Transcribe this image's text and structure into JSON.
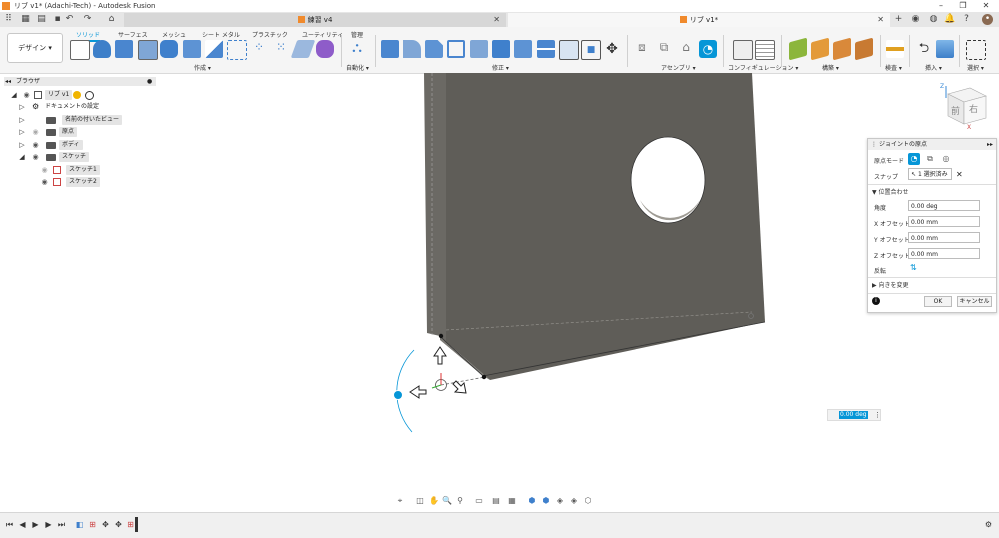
{
  "titlebar": {
    "title": "リブ v1* (Adachi-Tech) - Autodesk Fusion"
  },
  "doc_tabs": [
    {
      "label": "練習 v4"
    },
    {
      "label": "リブ v1*"
    }
  ],
  "toolbar": {
    "workspace": "デザイン ▾",
    "tabs": [
      "ソリッド",
      "サーフェス",
      "メッシュ",
      "シート メタル",
      "プラスチック",
      "ユーティリティ",
      "管理"
    ],
    "groups": [
      "作成 ▾",
      "自動化 ▾",
      "修正 ▾",
      "アセンブリ ▾",
      "コンフィギュレーション ▾",
      "構築 ▾",
      "検査 ▾",
      "挿入 ▾",
      "選択 ▾"
    ]
  },
  "browser": {
    "title": "ブラウザ",
    "items": [
      {
        "label": "リブ v1"
      },
      {
        "label": "ドキュメントの設定"
      },
      {
        "label": "名前の付いたビュー"
      },
      {
        "label": "原点"
      },
      {
        "label": "ボディ"
      },
      {
        "label": "スケッチ"
      },
      {
        "label": "スケッチ1"
      },
      {
        "label": "スケッチ2"
      }
    ]
  },
  "viewcube": {
    "front": "前",
    "right": "右",
    "axis_x": "X",
    "axis_z": "Z"
  },
  "joint_panel": {
    "title": "ジョイントの原点",
    "mode_label": "原点モード",
    "snap_label": "スナップ",
    "snap_value": "1 選択済み",
    "alignment_section": "位置合わせ",
    "angle_label": "角度",
    "angle_value": "0.00 deg",
    "x_label": "X オフセット",
    "x_value": "0.00 mm",
    "y_label": "Y オフセット",
    "y_value": "0.00 mm",
    "z_label": "Z オフセット",
    "z_value": "0.00 mm",
    "flip_label": "反転",
    "orientation_section": "向きを変更",
    "ok_label": "OK",
    "cancel_label": "キャンセル"
  },
  "heads_up": {
    "value": "0.00 deg"
  },
  "colors": {
    "accent": "#0696d7",
    "body": "#5f5d58"
  }
}
